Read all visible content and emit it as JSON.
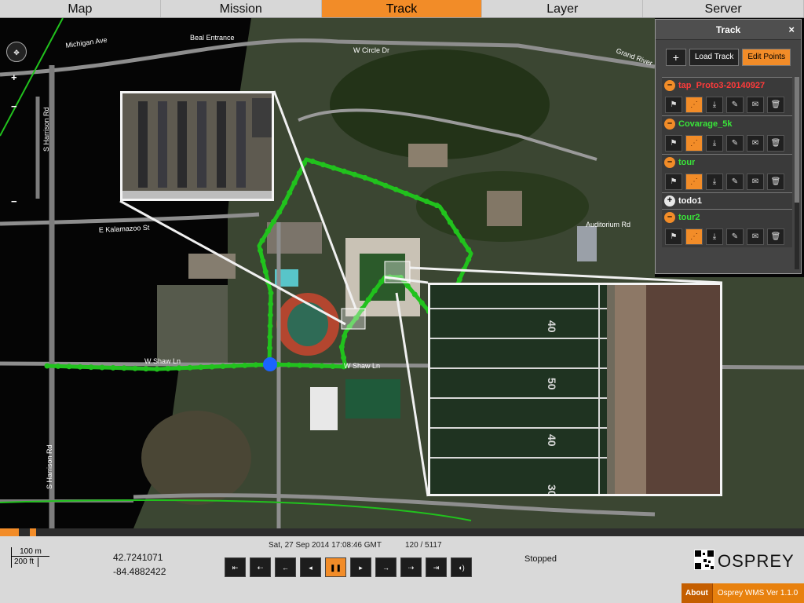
{
  "tabs": [
    {
      "label": "Map"
    },
    {
      "label": "Mission"
    },
    {
      "label": "Track"
    },
    {
      "label": "Layer"
    },
    {
      "label": "Server"
    }
  ],
  "active_tab": "Track",
  "map": {
    "street_labels": [
      "Michigan Ave",
      "Beal Entrance",
      "W Circle Dr",
      "Grand River",
      "S Harrison Rd",
      "E Kalamazoo St",
      "Auditorium Rd",
      "W Shaw Ln",
      "W Shaw Ln",
      "S Harrison Rd"
    ],
    "inset_big_labels": [
      "40",
      "50",
      "40",
      "30"
    ]
  },
  "panel": {
    "title": "Track",
    "close": "×",
    "add_label": "+",
    "load_label": "Load Track",
    "edit_label": "Edit Points",
    "tracks": [
      {
        "name": "tap_Proto3-20140927",
        "color": "#ff3a3a",
        "toggle": "–",
        "expanded": true
      },
      {
        "name": "Covarage_5k",
        "color": "#39e639",
        "toggle": "–",
        "expanded": true
      },
      {
        "name": "tour",
        "color": "#39e639",
        "toggle": "–",
        "expanded": true
      },
      {
        "name": "todo1",
        "color": "#ffffff",
        "toggle": "+",
        "expanded": false
      },
      {
        "name": "tour2",
        "color": "#39e639",
        "toggle": "–",
        "expanded": true
      }
    ]
  },
  "timeline": {
    "progress": 0.0235
  },
  "footer": {
    "scale_m": "100 m",
    "scale_ft": "200 ft",
    "lat": "42.7241071",
    "lon": "-84.4882422",
    "datetime": "Sat, 27 Sep 2014 17:08:46 GMT",
    "frame": "120 / 5117",
    "status": "Stopped",
    "logo": "OSPREY",
    "about": "About",
    "version": "Osprey WMS Ver 1.1.0"
  },
  "colors": {
    "accent": "#f28c28",
    "track_green": "#21c21d",
    "marker_blue": "#1b64ff"
  }
}
